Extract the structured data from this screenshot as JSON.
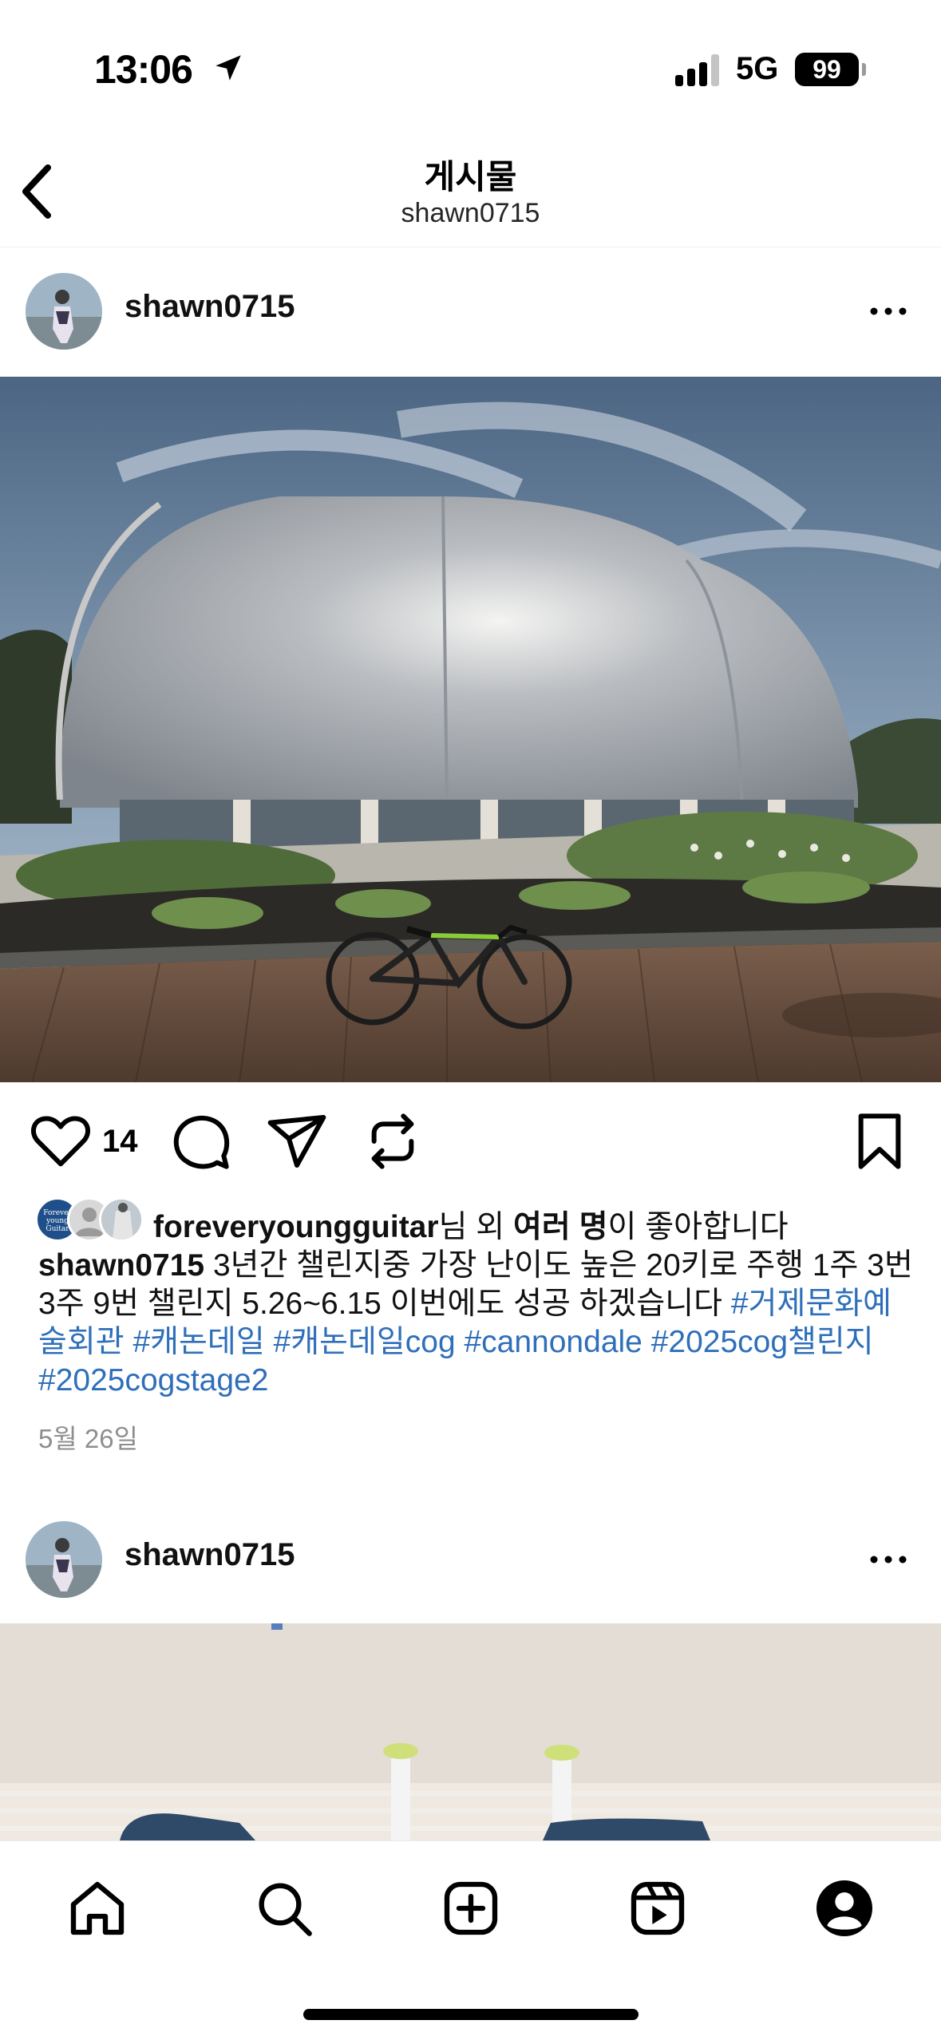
{
  "status_bar": {
    "time": "13:06",
    "network": "5G",
    "battery": "99"
  },
  "header": {
    "title": "게시물",
    "subtitle": "shawn0715"
  },
  "posts": [
    {
      "author": "shawn0715",
      "like_count": "14",
      "liked_by": {
        "avatar_text": "Forever young Guitar",
        "user": "foreveryoungguitar",
        "suffix_1": "님 외 ",
        "others": "여러 명",
        "suffix_2": "이 좋아합니다"
      },
      "caption": {
        "user": "shawn0715",
        "text": "3년간 챌린지중 가장 난이도 높은 20키로 주행 1주 3번 3주 9번 챌린지 5.26~6.15 이번에도 성공 하겠습니다",
        "hashtags": [
          "#거제문화예술회관",
          "#캐논데일",
          "#캐논데일cog",
          "#cannondale",
          "#2025cog챌린지",
          "#2025cogstage2"
        ]
      },
      "date": "5월 26일"
    },
    {
      "author": "shawn0715"
    }
  ],
  "colors": {
    "hashtag": "#2f6fba",
    "secondary_text": "#8e8e8e"
  },
  "tab_icons": [
    "home-icon",
    "search-icon",
    "create-icon",
    "reels-icon",
    "profile-icon"
  ]
}
